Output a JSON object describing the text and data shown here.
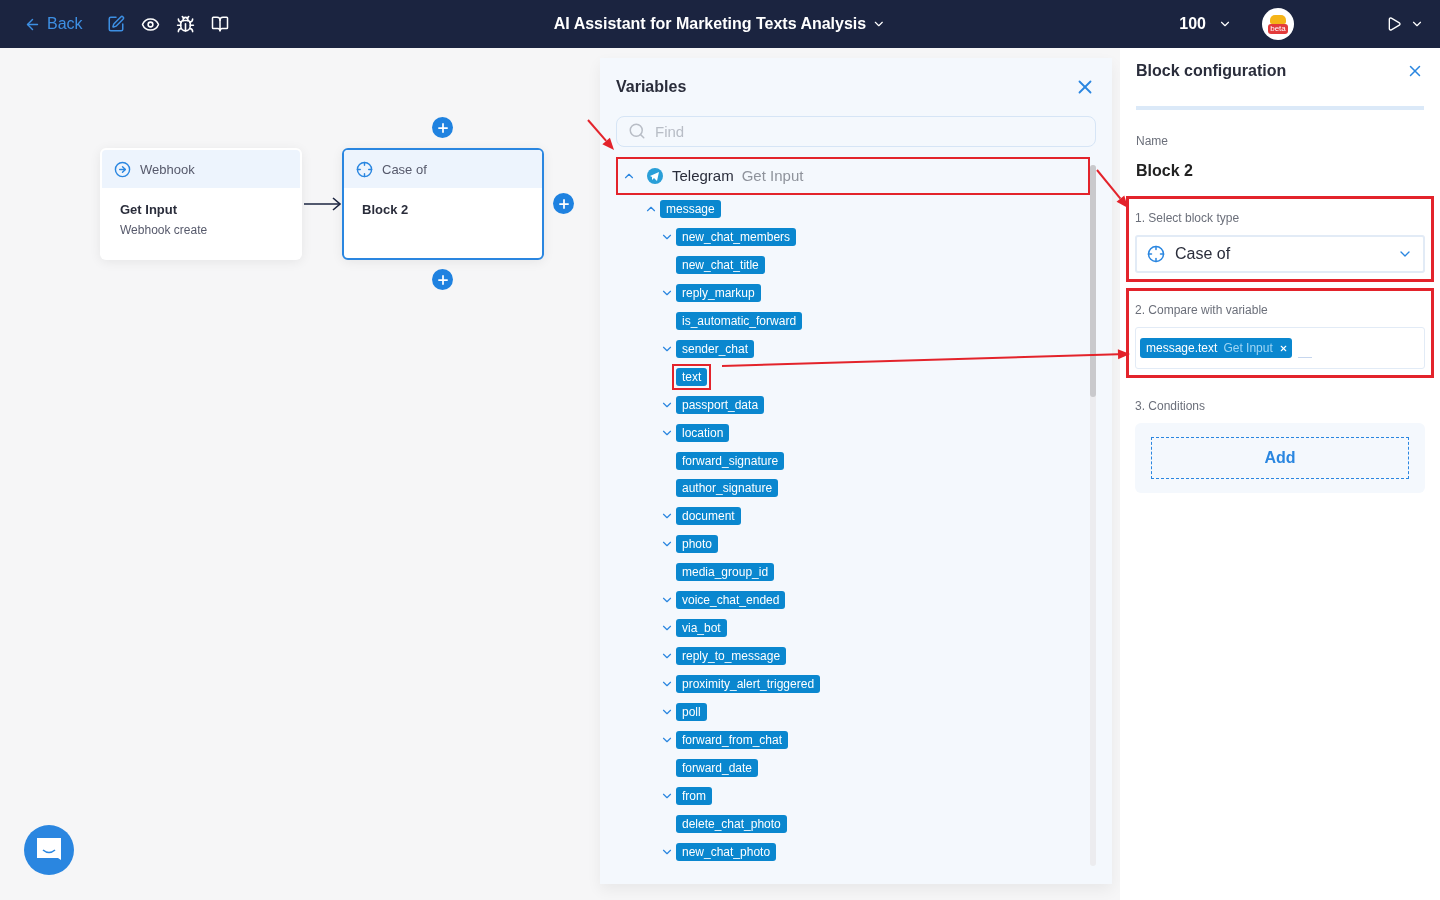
{
  "topbar": {
    "back": "Back",
    "title": "AI Assistant for Marketing Texts Analysis",
    "zoom": "100",
    "logo_badge": "beta"
  },
  "canvas": {
    "nodes": [
      {
        "kind": "trigger",
        "header": "Webhook",
        "title": "Get Input",
        "subtitle": "Webhook create",
        "selected": false
      },
      {
        "kind": "case",
        "header": "Case of",
        "title": "Block 2",
        "selected": true
      }
    ]
  },
  "variables": {
    "title": "Variables",
    "search": {
      "placeholder": "Find"
    },
    "tree": [
      {
        "label": "Telegram",
        "source": "Get Input",
        "expanded": true,
        "highlighted": true,
        "children": [
          {
            "label": "message",
            "kind": "group",
            "expanded": true,
            "highlighted": false,
            "children": [
              {
                "label": "new_chat_members",
                "kind": "group",
                "expanded": false,
                "highlighted": false
              },
              {
                "label": "new_chat_title",
                "kind": "field",
                "highlighted": false
              },
              {
                "label": "reply_markup",
                "kind": "group",
                "expanded": false,
                "highlighted": false
              },
              {
                "label": "is_automatic_forward",
                "kind": "field",
                "highlighted": false
              },
              {
                "label": "sender_chat",
                "kind": "group",
                "expanded": false,
                "highlighted": false
              },
              {
                "label": "text",
                "kind": "field",
                "highlighted": true
              },
              {
                "label": "passport_data",
                "kind": "group",
                "expanded": false,
                "highlighted": false
              },
              {
                "label": "location",
                "kind": "group",
                "expanded": false,
                "highlighted": false
              },
              {
                "label": "forward_signature",
                "kind": "field",
                "highlighted": false
              },
              {
                "label": "author_signature",
                "kind": "field",
                "highlighted": false
              },
              {
                "label": "document",
                "kind": "group",
                "expanded": false,
                "highlighted": false
              },
              {
                "label": "photo",
                "kind": "group",
                "expanded": false,
                "highlighted": false
              },
              {
                "label": "media_group_id",
                "kind": "field",
                "highlighted": false
              },
              {
                "label": "voice_chat_ended",
                "kind": "group",
                "expanded": false,
                "highlighted": false
              },
              {
                "label": "via_bot",
                "kind": "group",
                "expanded": false,
                "highlighted": false
              },
              {
                "label": "reply_to_message",
                "kind": "group",
                "expanded": false,
                "highlighted": false
              },
              {
                "label": "proximity_alert_triggered",
                "kind": "group",
                "expanded": false,
                "highlighted": false
              },
              {
                "label": "poll",
                "kind": "group",
                "expanded": false,
                "highlighted": false
              },
              {
                "label": "forward_from_chat",
                "kind": "group",
                "expanded": false,
                "highlighted": false
              },
              {
                "label": "forward_date",
                "kind": "field",
                "highlighted": false
              },
              {
                "label": "from",
                "kind": "group",
                "expanded": false,
                "highlighted": false
              },
              {
                "label": "delete_chat_photo",
                "kind": "field",
                "highlighted": false
              },
              {
                "label": "new_chat_photo",
                "kind": "group",
                "expanded": false,
                "highlighted": false
              }
            ]
          }
        ]
      }
    ]
  },
  "config": {
    "title": "Block configuration",
    "name_label": "Name",
    "name": "Block 2",
    "sections": [
      {
        "kind": "select",
        "label": "1. Select block type",
        "value": "Case of",
        "highlighted": true
      },
      {
        "kind": "variable",
        "label": "2. Compare with variable",
        "chip": {
          "name": "message.text",
          "source": "Get Input"
        },
        "highlighted": true
      },
      {
        "kind": "conditions",
        "label": "3. Conditions",
        "button": "Add",
        "highlighted": false
      }
    ]
  }
}
